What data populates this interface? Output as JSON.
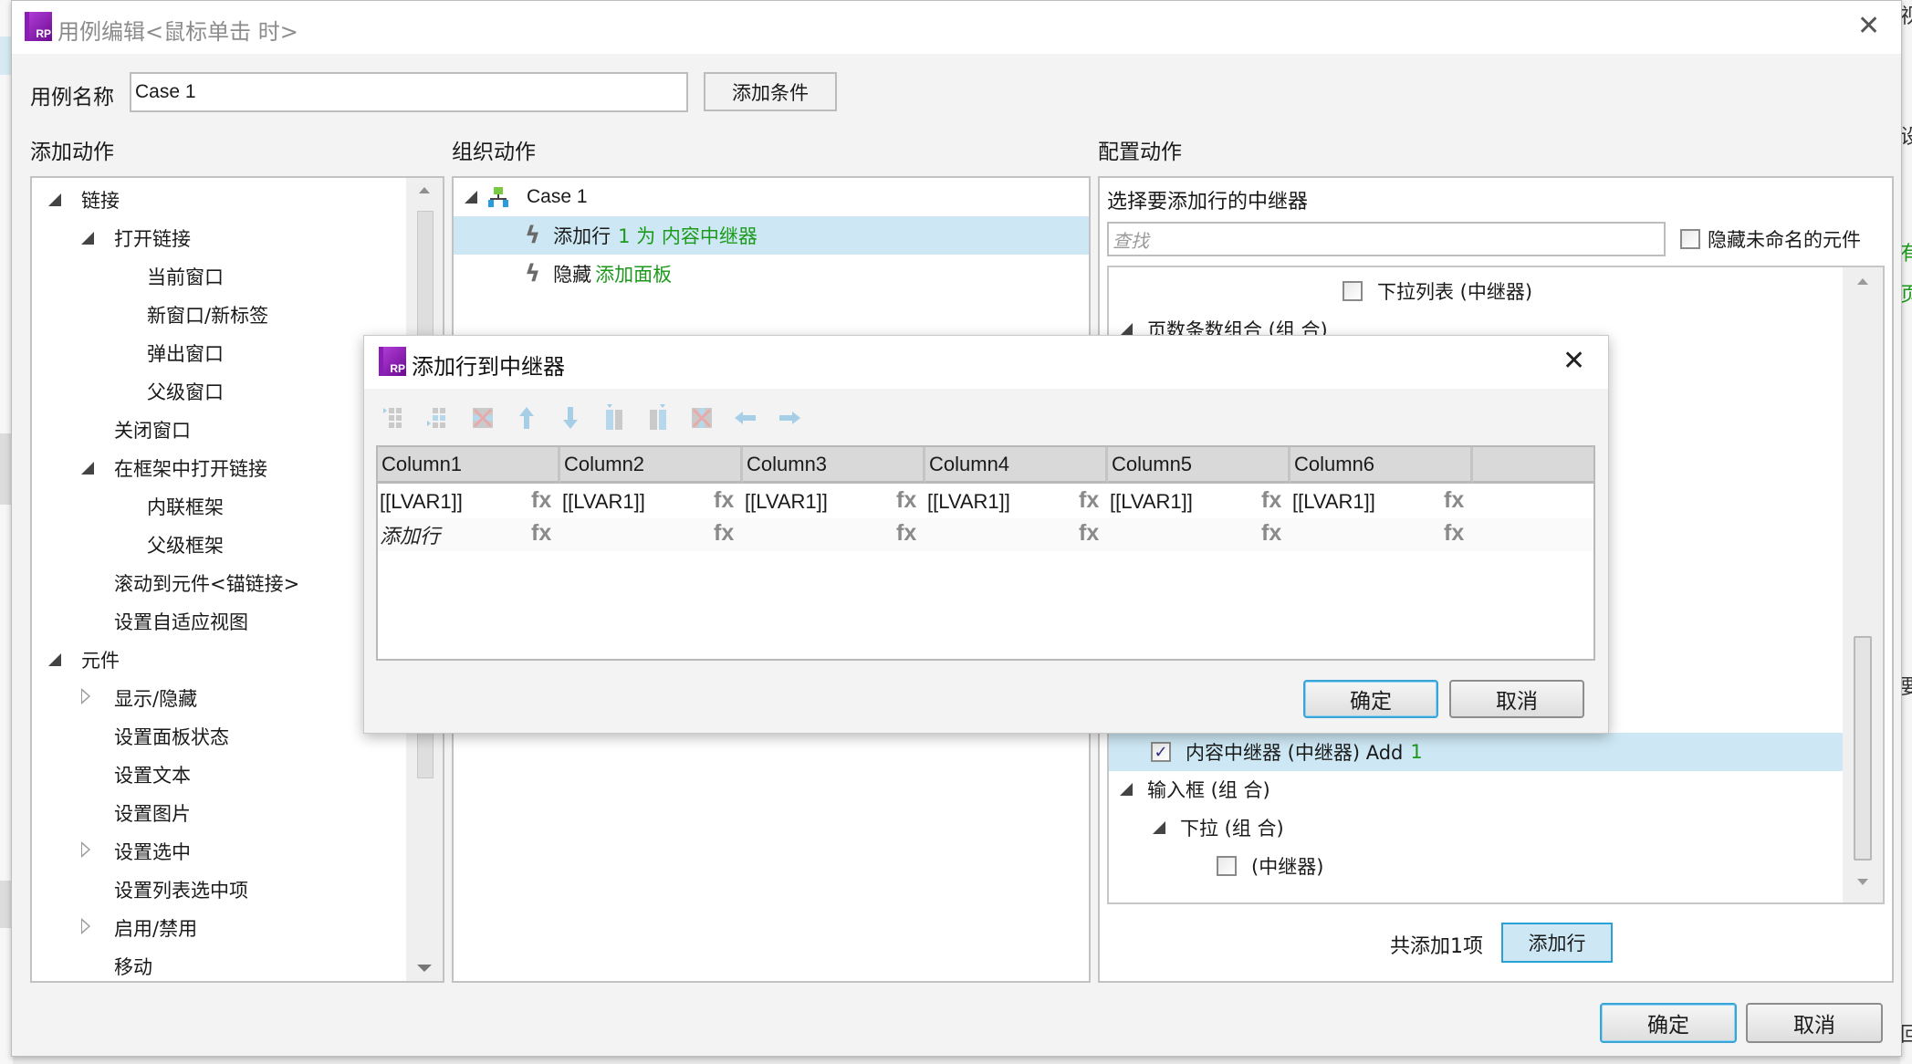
{
  "background": {
    "right_strip_glyphs": [
      "视",
      "设",
      "有",
      "页",
      "要",
      "回"
    ]
  },
  "main_dialog": {
    "title": "用例编辑<鼠标单击 时>",
    "logo_text": "RP",
    "case_name_label": "用例名称",
    "case_name_value": "Case 1",
    "add_condition_button": "添加条件",
    "ok_button": "确定",
    "cancel_button": "取消"
  },
  "add_actions": {
    "heading": "添加动作",
    "items": [
      {
        "label": "链接",
        "level": 0,
        "expander": "open"
      },
      {
        "label": "打开链接",
        "level": 1,
        "expander": "open"
      },
      {
        "label": "当前窗口",
        "level": 2,
        "expander": "none"
      },
      {
        "label": "新窗口/新标签",
        "level": 2,
        "expander": "none"
      },
      {
        "label": "弹出窗口",
        "level": 2,
        "expander": "none"
      },
      {
        "label": "父级窗口",
        "level": 2,
        "expander": "none"
      },
      {
        "label": "关闭窗口",
        "level": 1,
        "expander": "none"
      },
      {
        "label": "在框架中打开链接",
        "level": 1,
        "expander": "open"
      },
      {
        "label": "内联框架",
        "level": 2,
        "expander": "none"
      },
      {
        "label": "父级框架",
        "level": 2,
        "expander": "none"
      },
      {
        "label": "滚动到元件<锚链接>",
        "level": 1,
        "expander": "none"
      },
      {
        "label": "设置自适应视图",
        "level": 1,
        "expander": "none"
      },
      {
        "label": "元件",
        "level": 0,
        "expander": "open"
      },
      {
        "label": "显示/隐藏",
        "level": 1,
        "expander": "closed"
      },
      {
        "label": "设置面板状态",
        "level": 1,
        "expander": "none"
      },
      {
        "label": "设置文本",
        "level": 1,
        "expander": "none"
      },
      {
        "label": "设置图片",
        "level": 1,
        "expander": "none"
      },
      {
        "label": "设置选中",
        "level": 1,
        "expander": "closed"
      },
      {
        "label": "设置列表选中项",
        "level": 1,
        "expander": "none"
      },
      {
        "label": "启用/禁用",
        "level": 1,
        "expander": "closed"
      },
      {
        "label": "移动",
        "level": 1,
        "expander": "none"
      }
    ]
  },
  "organize_actions": {
    "heading": "组织动作",
    "case_label": "Case 1",
    "actions": [
      {
        "verb": "添加行",
        "detail": "1 为 内容中继器",
        "selected": true
      },
      {
        "verb": "隐藏",
        "detail": "添加面板",
        "selected": false
      }
    ]
  },
  "configure_actions": {
    "heading": "配置动作",
    "subheading": "选择要添加行的中继器",
    "search_placeholder": "查找",
    "hide_unnamed_label": "隐藏未命名的元件",
    "hide_unnamed_checked": false,
    "tree": [
      {
        "label": "下拉列表 (中继器)",
        "type": "checkbox",
        "checked": false
      },
      {
        "label": "页数条数组合 (组 合)",
        "type": "group"
      },
      {
        "label": "内容中继器 (中继器) Add",
        "suffix": "1",
        "type": "checkbox",
        "checked": true,
        "selected": true
      },
      {
        "label": "输入框 (组 合)",
        "type": "group"
      },
      {
        "label": "下拉 (组 合)",
        "type": "group"
      },
      {
        "label": "(中继器)",
        "type": "checkbox",
        "checked": false
      }
    ],
    "total_added": "共添加1项",
    "add_row_button": "添加行"
  },
  "modal": {
    "title": "添加行到中继器",
    "logo_text": "RP",
    "toolbar_icons": [
      "insert-row-above-icon",
      "insert-row-below-icon",
      "delete-row-icon",
      "move-up-icon",
      "move-down-icon",
      "insert-column-left-icon",
      "insert-column-right-icon",
      "delete-column-icon",
      "move-left-icon",
      "move-right-icon"
    ],
    "columns": [
      "Column1",
      "Column2",
      "Column3",
      "Column4",
      "Column5",
      "Column6"
    ],
    "rows": [
      [
        "[[LVAR1]]",
        "[[LVAR1]]",
        "[[LVAR1]]",
        "[[LVAR1]]",
        "[[LVAR1]]",
        "[[LVAR1]]"
      ]
    ],
    "add_row_placeholder": "添加行",
    "fx_label": "fx",
    "ok_button": "确定",
    "cancel_button": "取消"
  },
  "colors": {
    "accent_green": "#1b9a1b",
    "selection_blue": "#cde8f4",
    "default_button_border": "#3aa4d8",
    "logo_purple": "#8a1db5"
  }
}
